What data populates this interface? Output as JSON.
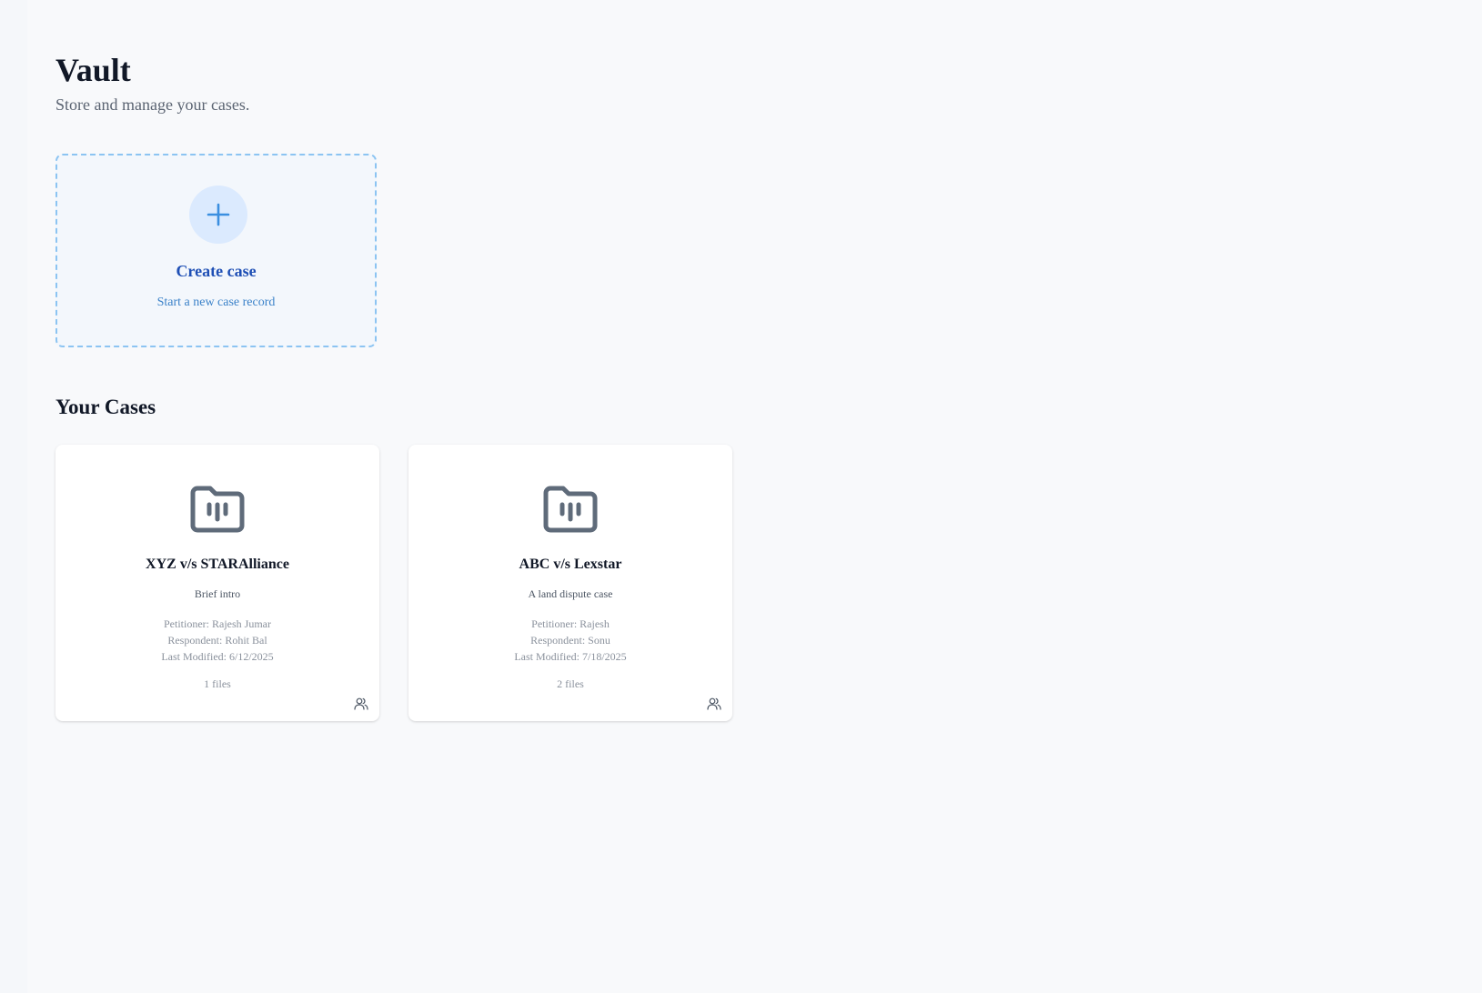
{
  "header": {
    "title": "Vault",
    "subtitle": "Store and manage your cases."
  },
  "create_card": {
    "icon": "plus-icon",
    "title": "Create case",
    "description": "Start a new case record"
  },
  "cases_section": {
    "title": "Your Cases",
    "cases": [
      {
        "icon": "folder-icon",
        "title": "XYZ v/s STARAlliance",
        "description": "Brief intro",
        "petitioner": "Petitioner: Rajesh Jumar",
        "respondent": "Respondent: Rohit Bal",
        "last_modified": "Last Modified: 6/12/2025",
        "files": "1 files",
        "share_icon": "users-icon"
      },
      {
        "icon": "folder-icon",
        "title": "ABC v/s Lexstar",
        "description": "A land dispute case",
        "petitioner": "Petitioner: Rajesh",
        "respondent": "Respondent: Sonu",
        "last_modified": "Last Modified: 7/18/2025",
        "files": "2 files",
        "share_icon": "users-icon"
      }
    ]
  },
  "colors": {
    "background": "#f8f9fb",
    "accent": "#1e4fb5",
    "dashed_border": "#8cc4f2",
    "plus_circle": "#dbeafe",
    "folder_icon": "#5f6b7a"
  }
}
